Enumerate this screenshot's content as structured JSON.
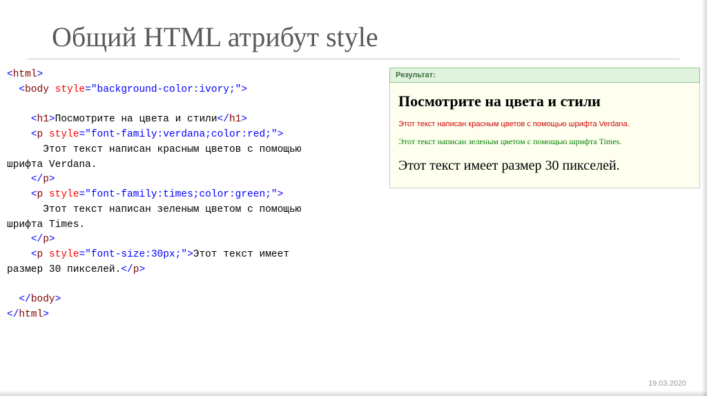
{
  "slide": {
    "title": "Общий HTML атрибут style",
    "date": "19.03.2020"
  },
  "code": {
    "l1_tag": "html",
    "l2_tag": "body",
    "l2_attr": "style",
    "l2_val": "\"background-color:ivory;\"",
    "l3_tag": "h1",
    "l3_text": "Посмотрите на цвета и стили",
    "l4_tag": "p",
    "l4_attr": "style",
    "l4_val": "\"font-family:verdana;color:red;\"",
    "l5_text": "      Этот текст написан красным цветов с помощью",
    "l6_text": "шрифта Verdana.",
    "l7_tag": "p",
    "l8_tag": "p",
    "l8_attr": "style",
    "l8_val": "\"font-family:times;color:green;\"",
    "l9_text": "      Этот текст написан зеленым цветом с помощью",
    "l10_text": "шрифта Times.",
    "l11_tag": "p",
    "l12_tag": "p",
    "l12_attr": "style",
    "l12_val": "\"font-size:30px;\"",
    "l12_text": "Этот текст имеет",
    "l13_text": "размер 30 пикселей.",
    "l13_tag": "p",
    "l14_tag": "body",
    "l15_tag": "html"
  },
  "result": {
    "header": "Результат:",
    "h1": "Посмотрите на цвета и стили",
    "p1": "Этот текст написан красным цветов с помощью шрифта Verdana.",
    "p2": "Этот текст написан зеленым цветом с помощью шрифта Times.",
    "p3": "Этот текст имеет размер 30 пикселей."
  }
}
